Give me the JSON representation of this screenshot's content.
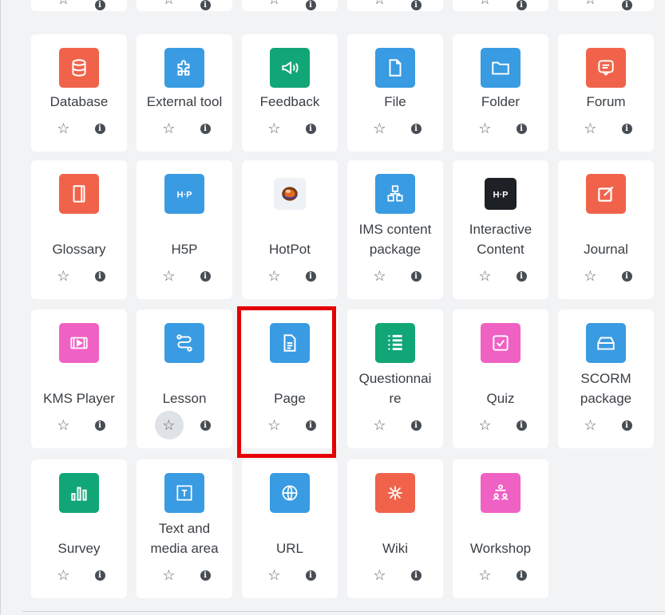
{
  "colors": {
    "orange": "#f0634a",
    "blue": "#399be2",
    "green": "#11a676",
    "pink": "#f061c4",
    "black": "#1d2125",
    "highlight": "#e60000"
  },
  "actions": {
    "star": "☆",
    "info": "i"
  },
  "rows": [
    {
      "items": [
        {
          "label": "Database",
          "icon": "database-icon",
          "color": "orange"
        },
        {
          "label": "External tool",
          "icon": "puzzle-icon",
          "color": "blue"
        },
        {
          "label": "Feedback",
          "icon": "megaphone-icon",
          "color": "green"
        },
        {
          "label": "File",
          "icon": "file-icon",
          "color": "blue"
        },
        {
          "label": "Folder",
          "icon": "folder-icon",
          "color": "blue"
        },
        {
          "label": "Forum",
          "icon": "forum-icon",
          "color": "orange"
        }
      ]
    },
    {
      "items": [
        {
          "label": "Glossary",
          "icon": "glossary-icon",
          "color": "orange"
        },
        {
          "label": "H5P",
          "icon": "h5p-icon",
          "color": "blue",
          "icon_text": "H·P"
        },
        {
          "label": "HotPot",
          "icon": "hotpot-icon",
          "color": "hotpot"
        },
        {
          "label": "IMS content\npackage",
          "icon": "ims-package-icon",
          "color": "blue"
        },
        {
          "label": "Interactive\nContent",
          "icon": "interactive-content-icon",
          "color": "black",
          "icon_text": "H·P"
        },
        {
          "label": "Journal",
          "icon": "journal-icon",
          "color": "orange"
        }
      ]
    },
    {
      "items": [
        {
          "label": "KMS Player",
          "icon": "kms-player-icon",
          "color": "pink"
        },
        {
          "label": "Lesson",
          "icon": "lesson-icon",
          "color": "blue",
          "star_hover": true
        },
        {
          "label": "Page",
          "icon": "page-icon",
          "color": "blue",
          "highlighted": true
        },
        {
          "label": "Questionnai\nre",
          "icon": "questionnaire-icon",
          "color": "green"
        },
        {
          "label": "Quiz",
          "icon": "quiz-icon",
          "color": "pink"
        },
        {
          "label": "SCORM\npackage",
          "icon": "scorm-icon",
          "color": "blue"
        }
      ]
    },
    {
      "items": [
        {
          "label": "Survey",
          "icon": "survey-icon",
          "color": "green"
        },
        {
          "label": "Text and\nmedia area",
          "icon": "text-media-icon",
          "color": "blue"
        },
        {
          "label": "URL",
          "icon": "url-icon",
          "color": "blue"
        },
        {
          "label": "Wiki",
          "icon": "wiki-icon",
          "color": "orange"
        },
        {
          "label": "Workshop",
          "icon": "workshop-icon",
          "color": "pink"
        }
      ]
    }
  ]
}
